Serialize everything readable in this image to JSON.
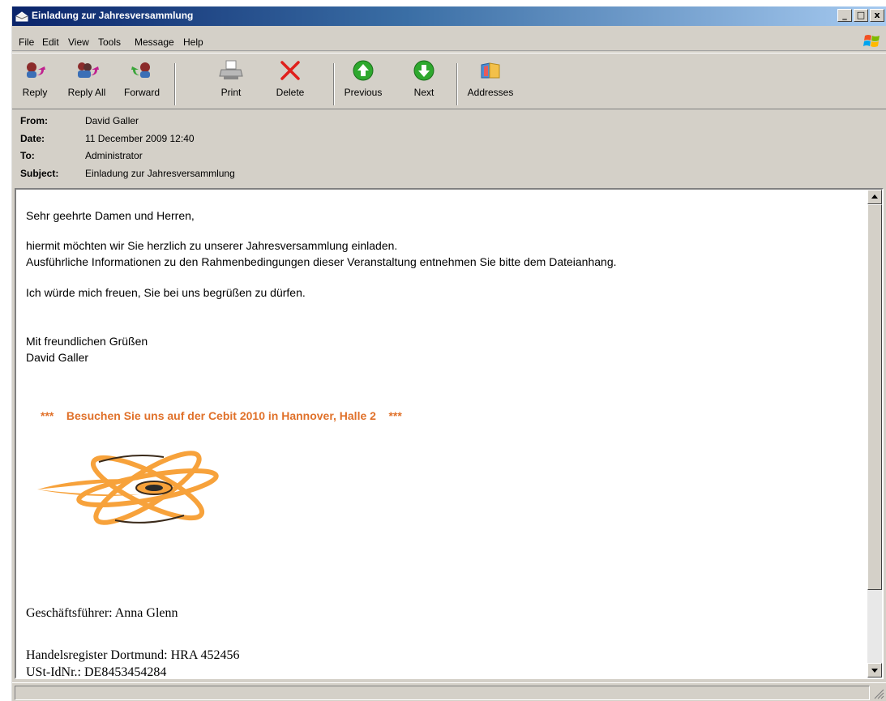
{
  "window": {
    "title": "Einladung zur Jahresversammlung",
    "controls": {
      "minimize": "_",
      "maximize": "□",
      "close": "x"
    }
  },
  "menu": [
    "File",
    "Edit",
    "View",
    "Tools",
    "Message",
    "Help"
  ],
  "toolbar": {
    "reply": "Reply",
    "reply_all": "Reply All",
    "forward": "Forward",
    "print": "Print",
    "delete": "Delete",
    "previous": "Previous",
    "next": "Next",
    "addresses": "Addresses"
  },
  "header": {
    "from_label": "From:",
    "from": "David Galler",
    "date_label": "Date:",
    "date": "11 December 2009 12:40",
    "to_label": "To:",
    "to": "Administrator",
    "subject_label": "Subject:",
    "subject": "Einladung zur Jahresversammlung"
  },
  "message": {
    "greeting": "Sehr geehrte Damen und Herren,",
    "line1": "hiermit möchten wir Sie herzlich zu unserer Jahresversammlung einladen.",
    "line2": "Ausführliche Informationen zu den Rahmenbedingungen dieser Veranstaltung entnehmen Sie bitte dem Dateianhang.",
    "line3": "Ich würde mich freuen, Sie bei uns begrüßen zu dürfen.",
    "closing": "Mit freundlichen Grüßen",
    "signature": "David Galler",
    "promo": "***    Besuchen Sie uns auf der Cebit 2010 in Hannover, Halle 2    ***",
    "ceo": "Geschäftsführer: Anna Glenn",
    "register": "Handelsregister Dortmund: HRA 452456",
    "vat": "USt-IdNr.: DE8453454284"
  },
  "colors": {
    "promo": "#e0712a",
    "logo_orange": "#f7a23b",
    "titlebar_start": "#0a246a",
    "chrome": "#d4d0c8"
  },
  "icons": {
    "reply": "reply-icon",
    "reply_all": "reply-all-icon",
    "forward": "forward-icon",
    "print": "printer-icon",
    "delete": "delete-x-icon",
    "previous": "up-arrow-icon",
    "next": "down-arrow-icon",
    "addresses": "address-book-icon"
  }
}
